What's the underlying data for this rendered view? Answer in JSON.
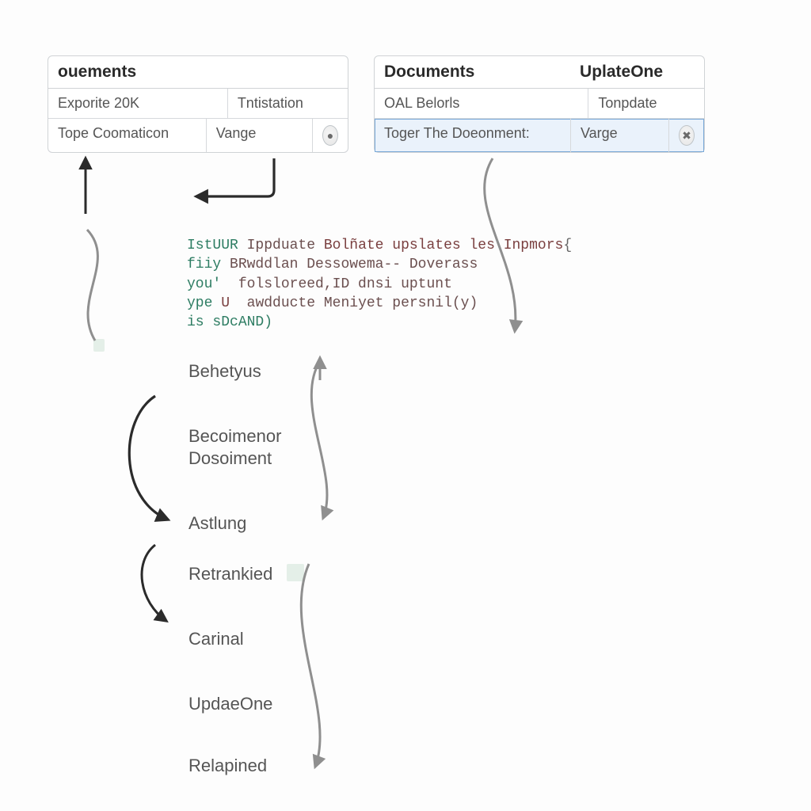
{
  "leftPanel": {
    "title": "ouements",
    "rows": [
      {
        "c1": "Exporite 20K",
        "c2": "Tntistation"
      },
      {
        "c1": "Tope Coomaticon",
        "c2": "Vange",
        "icon": "●"
      }
    ]
  },
  "rightPanel": {
    "titleLeft": "Documents",
    "titleRight": "UplateOne",
    "rows": [
      {
        "c1": "OAL Belorls",
        "c2": "Tonpdate"
      },
      {
        "c1": "Toger The Doeonment:",
        "c2": "Varge",
        "icon": "✖",
        "selected": true
      }
    ]
  },
  "code": {
    "l1a": "IstUUR",
    "l1b": "Ippduate",
    "l1c": "Bolñate upslates les Inpmors",
    "l1d": "{",
    "l2a": "fiiy",
    "l2b": "BRwddlan Dessowema-- Doverass",
    "l3a": "you'",
    "l3b": "folsloreed,",
    "l3c": "ID dnsi uptunt",
    "l4a": "ype",
    "l4b": "U",
    "l4c": "awdducte Meniyet persnil(y)",
    "l5a": "is",
    "l5b": "sDcAND)"
  },
  "labels": {
    "a": "Behetyus",
    "b1": "Becoimenor",
    "b2": "Dosoiment",
    "c": "Astlung",
    "d": "Retrankied",
    "e": "Carinal",
    "f": "UpdaeOne",
    "g": "Relapined"
  }
}
